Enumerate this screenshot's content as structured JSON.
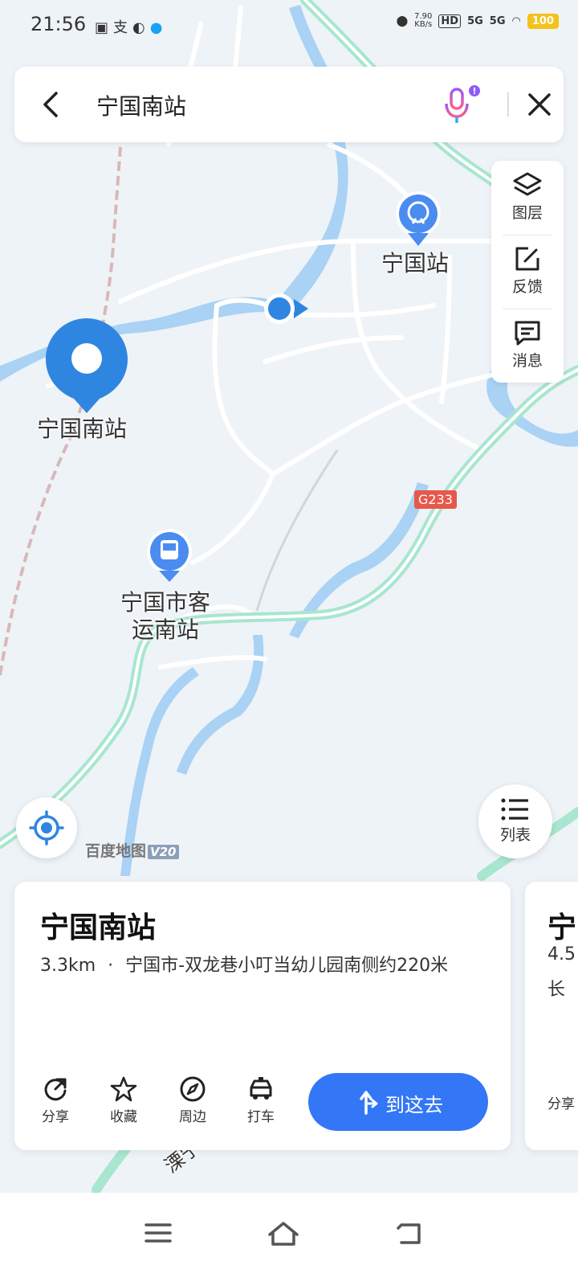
{
  "status_bar": {
    "time": "21:56",
    "left_icons": [
      "clipboard-icon",
      "alipay-icon",
      "wechat-icon",
      "qq-icon"
    ],
    "net_speed": "7.90",
    "net_unit": "KB/s",
    "hd": "HD",
    "sim1": "5G",
    "sim2": "5G",
    "battery": "100"
  },
  "search": {
    "query": "宁国南站",
    "icons": [
      "back-arrow-icon",
      "voice-mic-icon",
      "close-icon"
    ]
  },
  "side_tools": [
    {
      "label": "图层",
      "icon": "layers-icon"
    },
    {
      "label": "反馈",
      "icon": "feedback-icon"
    },
    {
      "label": "消息",
      "icon": "message-icon"
    }
  ],
  "map": {
    "pois": {
      "selected": "宁国南站",
      "train_station": "宁国站",
      "bus_station_line1": "宁国市客",
      "bus_station_line2": "运南站",
      "road_bottom": "溧宁高"
    },
    "road_shield": "G233",
    "brand": "百度地图",
    "brand_version": "V20",
    "colors": {
      "water": "#a9d2f4",
      "expressway": "#a8e6cf",
      "road": "#ffffff",
      "railway": "#d8b8b8",
      "selected_marker": "#2f86e0"
    }
  },
  "list_button": {
    "label": "列表",
    "icon": "list-icon"
  },
  "locate_button": {
    "icon": "locate-icon"
  },
  "card": {
    "title": "宁国南站",
    "distance": "3.3km",
    "separator": "·",
    "address": "宁国市-双龙巷小叮当幼儿园南侧约220米",
    "actions": [
      {
        "label": "分享",
        "icon": "share-icon"
      },
      {
        "label": "收藏",
        "icon": "star-icon"
      },
      {
        "label": "周边",
        "icon": "compass-icon"
      },
      {
        "label": "打车",
        "icon": "taxi-icon"
      }
    ],
    "go_label": "到这去"
  },
  "card_peek": {
    "title_part": "宁",
    "line1_part": "4.5",
    "line2_part": "长",
    "action_part": "分享"
  },
  "nav_bar": [
    "menu-icon",
    "home-icon",
    "back-icon"
  ]
}
